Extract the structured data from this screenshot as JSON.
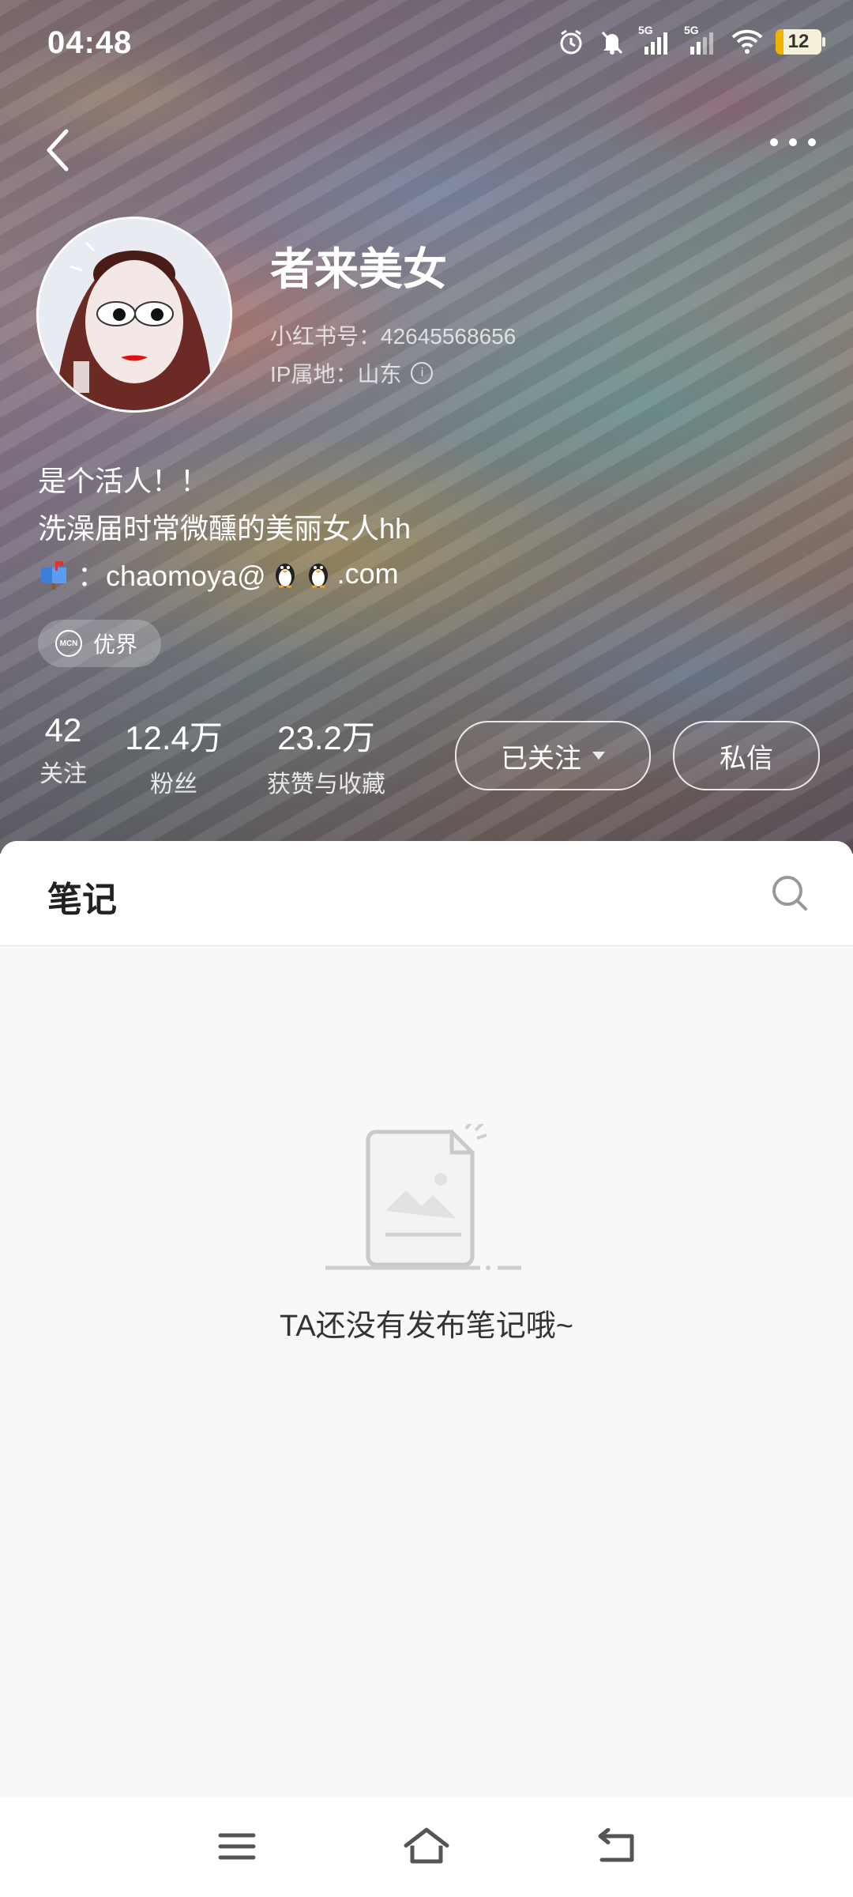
{
  "status_bar": {
    "time": "04:48",
    "icons": [
      "alarm-icon",
      "bell-off-icon",
      "signal-5g-icon",
      "signal-5g-icon",
      "wifi-icon"
    ],
    "signal_label_1": "5G",
    "signal_label_2": "5G",
    "battery": "12"
  },
  "nav": {
    "back_icon": "chevron-left-icon",
    "more_icon": "more-horizontal-icon"
  },
  "profile": {
    "name": "者来美女",
    "id_line": "小红书号：42645568656",
    "ip_line": "IP属地：山东",
    "bio": [
      "是个活人！！",
      "洗澡届时常微醺的美丽女人hh"
    ],
    "email_prefix": "：chaomoya@",
    "email_suffix": ".com",
    "mcn_icon": "MCN",
    "tag": "优界"
  },
  "stats": [
    {
      "value": "42",
      "label": "关注"
    },
    {
      "value": "12.4万",
      "label": "粉丝"
    },
    {
      "value": "23.2万",
      "label": "获赞与收藏"
    }
  ],
  "actions": {
    "follow": "已关注",
    "message": "私信"
  },
  "content": {
    "tab": "笔记",
    "empty_text": "TA还没有发布笔记哦~"
  },
  "bottom_nav": [
    "menu-icon",
    "home-icon",
    "back-icon"
  ]
}
